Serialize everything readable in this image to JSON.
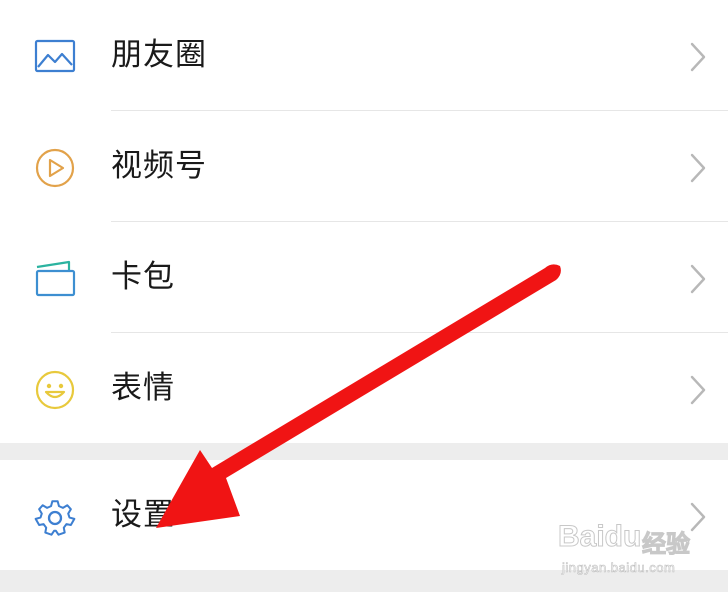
{
  "menu": {
    "items": [
      {
        "label": "朋友圈",
        "icon": "moments-image-icon"
      },
      {
        "label": "视频号",
        "icon": "channels-play-icon"
      },
      {
        "label": "卡包",
        "icon": "card-wallet-icon"
      },
      {
        "label": "表情",
        "icon": "sticker-smiley-icon"
      }
    ],
    "settings": {
      "label": "设置",
      "icon": "gear-icon"
    }
  },
  "annotation": {
    "arrow_color": "#f01414",
    "points_to": "设置"
  },
  "watermark": {
    "brand": "Baidu",
    "product": "经验",
    "url": "jingyan.baidu.com"
  },
  "colors": {
    "moments_icon": "#3d7fd1",
    "channels_icon": "#e2a24a",
    "card_icon": "#3d8fd1",
    "sticker_icon": "#e8c93c",
    "settings_icon": "#3d7fd1",
    "chevron": "#b8b8b8",
    "section_gap": "#ededed"
  }
}
